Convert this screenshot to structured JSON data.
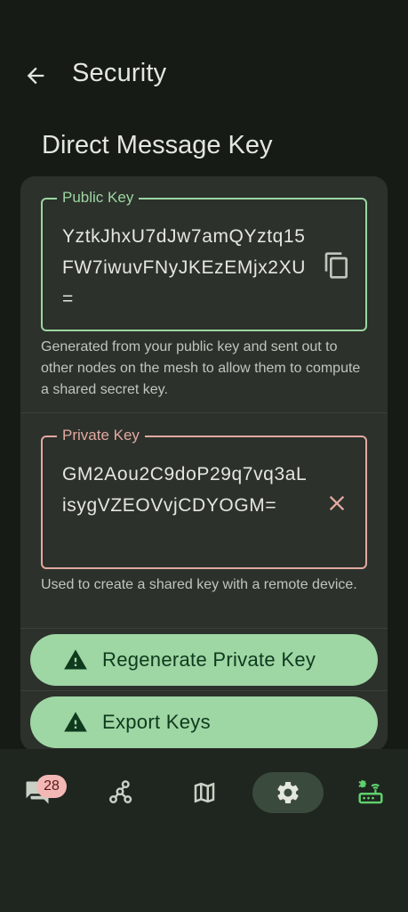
{
  "header": {
    "title": "Security",
    "back_icon": "arrow-left-icon"
  },
  "section": {
    "title": "Direct Message Key"
  },
  "public_key": {
    "label": "Public Key",
    "value": "YztkJhxU7dJw7amQYztq15FW7iwuvFNyJKEzEMjx2XU=",
    "action_icon": "copy-icon",
    "helper": "Generated from your public key and sent out to other nodes on the mesh to allow them to compute a shared secret key.",
    "accent": "#9bd6a2"
  },
  "private_key": {
    "label": "Private Key",
    "value": "GM2Aou2C9doP29q7vq3aLisygVZEOVvjCDYOGM=",
    "action_icon": "close-icon",
    "helper": "Used to create a shared key with a remote device.",
    "accent": "#e2a9a1"
  },
  "buttons": {
    "regenerate": "Regenerate Private Key",
    "export": "Export Keys",
    "icon": "warning-icon",
    "background": "#9ed6a4"
  },
  "nav": {
    "messages_badge": "28",
    "items": [
      "messages-icon",
      "nodes-icon",
      "map-icon",
      "settings-icon",
      "radio-connected-icon"
    ],
    "active": "settings-icon"
  }
}
